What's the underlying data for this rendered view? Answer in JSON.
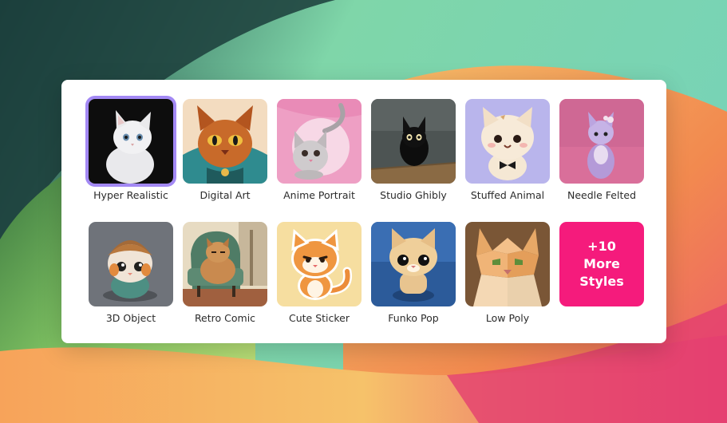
{
  "styles": {
    "selected_index": 0,
    "items": [
      {
        "label": "Hyper Realistic",
        "icon": "kitten-photo"
      },
      {
        "label": "Digital Art",
        "icon": "ornate-cat-art"
      },
      {
        "label": "Anime Portrait",
        "icon": "anime-cat"
      },
      {
        "label": "Studio Ghibly",
        "icon": "black-cat"
      },
      {
        "label": "Stuffed Animal",
        "icon": "plush-cat"
      },
      {
        "label": "Needle Felted",
        "icon": "felted-cat"
      },
      {
        "label": "3D Object",
        "icon": "3d-cat"
      },
      {
        "label": "Retro Comic",
        "icon": "comic-cat-on-chair"
      },
      {
        "label": "Cute Sticker",
        "icon": "sticker-cat"
      },
      {
        "label": "Funko Pop",
        "icon": "funko-cat"
      },
      {
        "label": "Low Poly",
        "icon": "low-poly-cat"
      }
    ],
    "more_label": "+10 More Styles"
  },
  "colors": {
    "selected_border": "#a389f4",
    "more_button": "#f51b7c"
  }
}
